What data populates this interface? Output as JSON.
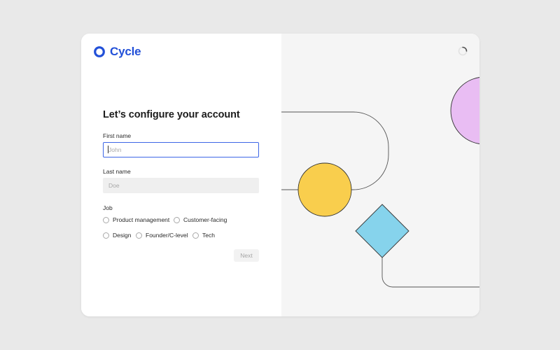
{
  "brand": {
    "name": "Cycle",
    "color": "#2250d8"
  },
  "form": {
    "title": "Let’s configure your account",
    "first_name": {
      "label": "First name",
      "placeholder": "John",
      "value": ""
    },
    "last_name": {
      "label": "Last name",
      "placeholder": "Doe",
      "value": ""
    },
    "job": {
      "label": "Job",
      "options": [
        "Product management",
        "Customer-facing",
        "Design",
        "Founder/C-level",
        "Tech"
      ]
    },
    "next_label": "Next"
  },
  "illustration": {
    "shapes": [
      {
        "name": "pink-circle",
        "color": "#e9bdf3"
      },
      {
        "name": "yellow-circle",
        "color": "#f9ce4d"
      },
      {
        "name": "blue-diamond",
        "color": "#86d3ec"
      }
    ]
  },
  "icons": {
    "logo": "cycle-logo-icon",
    "loading": "loading-spinner-icon"
  }
}
